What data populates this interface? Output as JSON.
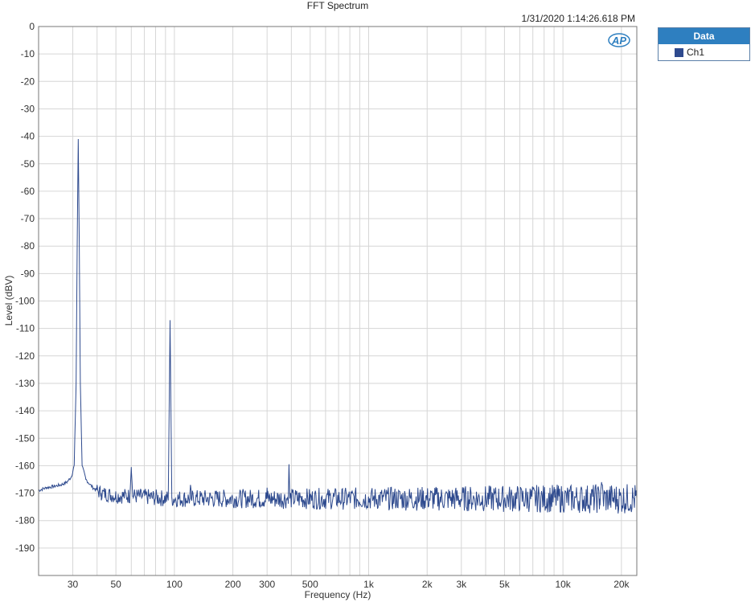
{
  "chart_data": {
    "type": "line",
    "title": "FFT Spectrum",
    "timestamp": "1/31/2020 1:14:26.618 PM",
    "xlabel": "Frequency (Hz)",
    "ylabel": "Level (dBV)",
    "xscale": "log",
    "xlim": [
      20,
      24000
    ],
    "ylim": [
      -200,
      0
    ],
    "grid": true,
    "y_ticks": [
      0,
      -10,
      -20,
      -30,
      -40,
      -50,
      -60,
      -70,
      -80,
      -90,
      -100,
      -110,
      -120,
      -130,
      -140,
      -150,
      -160,
      -170,
      -180,
      -190
    ],
    "x_ticks": [
      {
        "value": 30,
        "label": "30"
      },
      {
        "value": 50,
        "label": "50"
      },
      {
        "value": 100,
        "label": "100"
      },
      {
        "value": 200,
        "label": "200"
      },
      {
        "value": 300,
        "label": "300"
      },
      {
        "value": 500,
        "label": "500"
      },
      {
        "value": 1000,
        "label": "1k"
      },
      {
        "value": 2000,
        "label": "2k"
      },
      {
        "value": 3000,
        "label": "3k"
      },
      {
        "value": 5000,
        "label": "5k"
      },
      {
        "value": 10000,
        "label": "10k"
      },
      {
        "value": 20000,
        "label": "20k"
      }
    ],
    "legend": {
      "title": "Data",
      "placement": "top-right"
    },
    "series": [
      {
        "name": "Ch1",
        "color": "#2e4a8e",
        "noise_floor": -172,
        "noise_spread": 4,
        "points": [
          [
            20,
            -169
          ],
          [
            22,
            -168
          ],
          [
            24,
            -167.5
          ],
          [
            26,
            -167
          ],
          [
            28,
            -166
          ],
          [
            29.5,
            -164
          ],
          [
            30.5,
            -160
          ],
          [
            31.2,
            -130
          ],
          [
            31.6,
            -80
          ],
          [
            32,
            -41
          ],
          [
            32.4,
            -80
          ],
          [
            32.8,
            -130
          ],
          [
            33.5,
            -160
          ],
          [
            35,
            -165
          ],
          [
            38,
            -168
          ],
          [
            42,
            -170
          ],
          [
            50,
            -171
          ],
          [
            59,
            -171
          ],
          [
            60,
            -160.5
          ],
          [
            61,
            -171
          ],
          [
            93,
            -172
          ],
          [
            95,
            -107
          ],
          [
            97,
            -172
          ],
          [
            120,
            -172
          ],
          [
            121,
            -167
          ],
          [
            122,
            -172
          ],
          [
            298,
            -172
          ],
          [
            300,
            -168
          ],
          [
            302,
            -172
          ],
          [
            385,
            -172
          ],
          [
            389,
            -159.5
          ],
          [
            393,
            -172
          ],
          [
            15500,
            -172
          ],
          [
            15800,
            -166
          ],
          [
            16100,
            -172
          ],
          [
            24000,
            -172
          ]
        ]
      }
    ]
  },
  "logo": {
    "text": "AP"
  }
}
